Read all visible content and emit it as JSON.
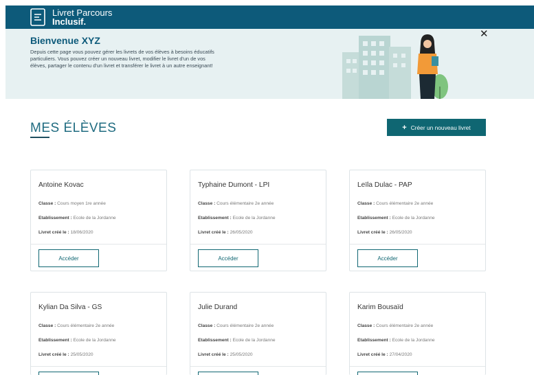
{
  "header": {
    "app_name_line1": "Livret Parcours",
    "app_name_line2": "Inclusif."
  },
  "banner": {
    "title": "Bienvenue XYZ",
    "text": "Depuis cette page vous pouvez gérer les livrets de vos élèves à besoins éducatifs particuliers. Vous pouvez créer un nouveau livret, modifier le livret d'un de vos élèves, partager le contenu d'un livret et transférer le livret à un autre enseignant!",
    "close": "✕"
  },
  "section": {
    "title": "MES ÉLÈVES",
    "create_button": "Créer un nouveau livret",
    "create_icon": "+"
  },
  "labels": {
    "classe": "Classe :",
    "etablissement": "Etablissement :",
    "livret": "Livret créé le :",
    "access_button": "Accéder"
  },
  "students": [
    {
      "name": "Antoine Kovac",
      "classe": "Cours moyen 1re année",
      "etablissement": "Ecole de la Jordanne",
      "date": "18/06/2020"
    },
    {
      "name": "Typhaine Dumont - LPI",
      "classe": "Cours élémentaire 2e année",
      "etablissement": "Ecole de la Jordanne",
      "date": "26/05/2020"
    },
    {
      "name": "Leïla Dulac - PAP",
      "classe": "Cours élémentaire 2e année",
      "etablissement": "Ecole de la Jordanne",
      "date": "26/05/2020"
    },
    {
      "name": "Kylian Da Silva - GS",
      "classe": "Cours élémentaire 2e année",
      "etablissement": "Ecole de la Jordanne",
      "date": "25/05/2020"
    },
    {
      "name": "Julie Durand",
      "classe": "Cours élémentaire 2e année",
      "etablissement": "Ecole de la Jordanne",
      "date": "25/05/2020"
    },
    {
      "name": "Karim Bousaïd",
      "classe": "Cours élémentaire 2e année",
      "etablissement": "Ecole de la Jordanne",
      "date": "27/04/2020"
    }
  ],
  "colors": {
    "brand": "#0d5a7a",
    "accent": "#0f6672",
    "banner_bg": "#e7f1f2"
  }
}
